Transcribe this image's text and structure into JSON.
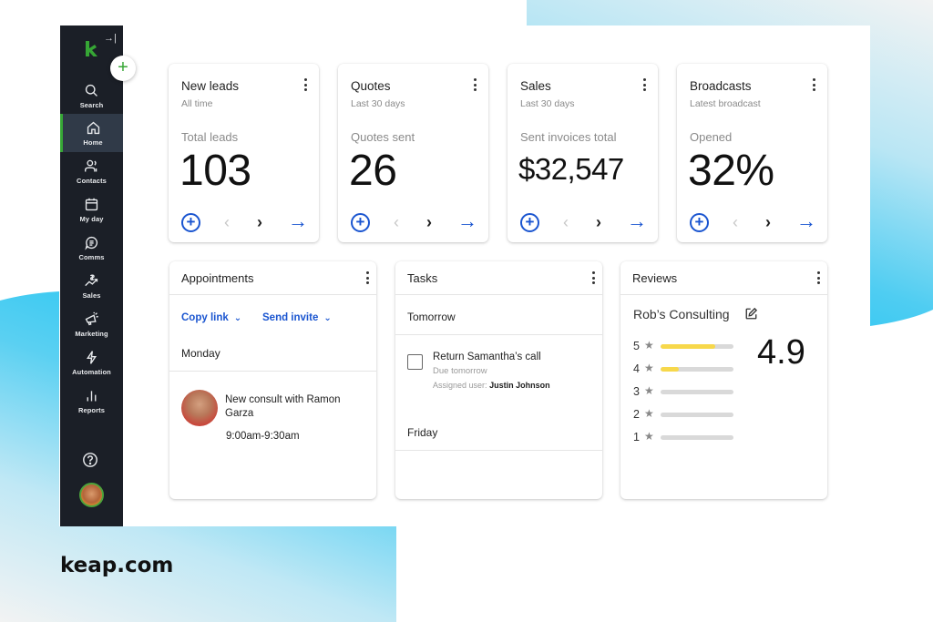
{
  "brand": {
    "footer_label": "keap.com",
    "accent": "#36a635",
    "link_color": "#1a55d0"
  },
  "sidebar": {
    "collapse_icon": "collapse-right-icon",
    "logo": "keap-logo",
    "add_button": "+",
    "items": [
      {
        "label": "Search",
        "icon": "search-icon",
        "active": false
      },
      {
        "label": "Home",
        "icon": "home-icon",
        "active": true
      },
      {
        "label": "Contacts",
        "icon": "contacts-icon",
        "active": false
      },
      {
        "label": "My day",
        "icon": "calendar-icon",
        "active": false
      },
      {
        "label": "Comms",
        "icon": "chat-icon",
        "active": false
      },
      {
        "label": "Sales",
        "icon": "sales-icon",
        "active": false
      },
      {
        "label": "Marketing",
        "icon": "megaphone-icon",
        "active": false
      },
      {
        "label": "Automation",
        "icon": "lightning-icon",
        "active": false
      },
      {
        "label": "Reports",
        "icon": "bar-chart-icon",
        "active": false
      }
    ],
    "help_icon": "help-icon",
    "user_avatar": "user-avatar"
  },
  "kpis": [
    {
      "title": "New leads",
      "subtitle": "All time",
      "label": "Total leads",
      "value": "103"
    },
    {
      "title": "Quotes",
      "subtitle": "Last 30 days",
      "label": "Quotes sent",
      "value": "26"
    },
    {
      "title": "Sales",
      "subtitle": "Last 30 days",
      "label": "Sent invoices total",
      "value": "$32,547"
    },
    {
      "title": "Broadcasts",
      "subtitle": "Latest broadcast",
      "label": "Opened",
      "value": "32%"
    }
  ],
  "kpi_actions": {
    "add": "+",
    "prev": "‹",
    "next": "›",
    "go": "→"
  },
  "appointments": {
    "title": "Appointments",
    "copy_link": "Copy link",
    "send_invite": "Send invite",
    "chevron": "⌄",
    "day": "Monday",
    "items": [
      {
        "title": "New consult with Ramon Garza",
        "time": "9:00am-9:30am"
      }
    ]
  },
  "tasks": {
    "title": "Tasks",
    "groups": [
      {
        "day": "Tomorrow",
        "items": [
          {
            "title": "Return Samantha’s call",
            "due": "Due tomorrow",
            "assigned_label": "Assigned user:",
            "assigned_user": "Justin Johnson",
            "done": false
          }
        ]
      },
      {
        "day": "Friday",
        "items": []
      }
    ]
  },
  "reviews": {
    "title": "Reviews",
    "business": "Rob’s Consulting",
    "score": "4.9",
    "star": "★",
    "breakdown": [
      {
        "stars": "5",
        "fraction": 0.75
      },
      {
        "stars": "4",
        "fraction": 0.25
      },
      {
        "stars": "3",
        "fraction": 0
      },
      {
        "stars": "2",
        "fraction": 0
      },
      {
        "stars": "1",
        "fraction": 0
      }
    ]
  }
}
